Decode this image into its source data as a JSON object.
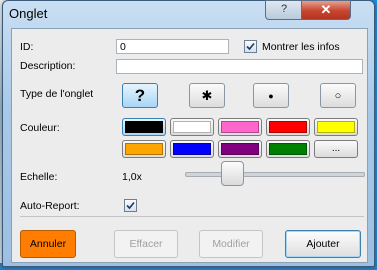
{
  "window": {
    "title": "Onglet",
    "help_label": "?",
    "close_label": "✕"
  },
  "form": {
    "id_label": "ID:",
    "id_value": "0",
    "show_info_label": "Montrer les infos",
    "show_info_checked": true,
    "description_label": "Description:",
    "description_value": "",
    "shape_label": "Type de l'onglet",
    "shapes": [
      {
        "name": "question",
        "glyph": "?",
        "selected": true
      },
      {
        "name": "asterisk",
        "glyph": "✱",
        "selected": false
      },
      {
        "name": "dot",
        "glyph": "●",
        "selected": false
      },
      {
        "name": "circle",
        "glyph": "○",
        "selected": false
      }
    ],
    "color_label": "Couleur:",
    "colors_row1": [
      "#000000",
      "#ffffff",
      "#ff66cc",
      "#ff0000",
      "#ffff00"
    ],
    "colors_row2": [
      "#ffa500",
      "#0000ff",
      "#800080",
      "#008000"
    ],
    "more_colors_label": "...",
    "scale_label": "Echelle:",
    "scale_value": "1,0x",
    "auto_report_label": "Auto-Report:",
    "auto_report_checked": true
  },
  "buttons": {
    "cancel": "Annuler",
    "clear": "Effacer",
    "modify": "Modifier",
    "add": "Ajouter"
  }
}
